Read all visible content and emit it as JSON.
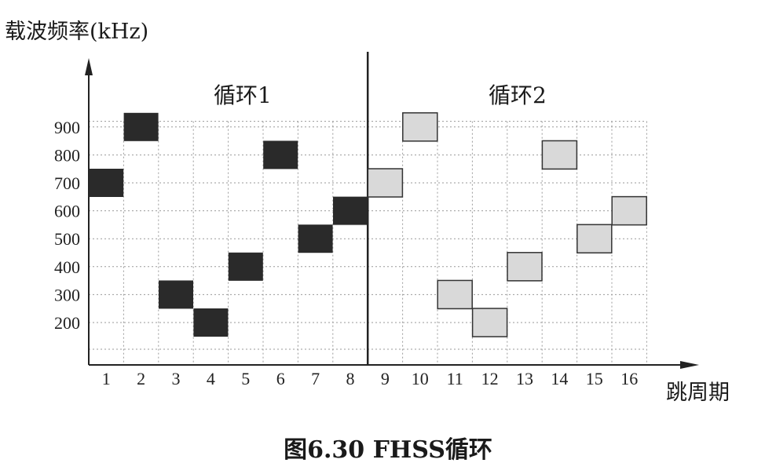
{
  "chart_data": {
    "type": "scatter",
    "title": "图6.30  FHSS循环",
    "ylabel": "载波频率(kHz)",
    "xlabel": "跳周期",
    "x_ticks": [
      1,
      2,
      3,
      4,
      5,
      6,
      7,
      8,
      9,
      10,
      11,
      12,
      13,
      14,
      15,
      16
    ],
    "y_ticks": [
      200,
      300,
      400,
      500,
      600,
      700,
      800,
      900
    ],
    "xlim": [
      0.5,
      16.5
    ],
    "ylim": [
      0,
      1000
    ],
    "grid": true,
    "cycle_divider_x": 8.5,
    "annotations": [
      "循环1",
      "循环2"
    ],
    "series": [
      {
        "color": "#2a2a2a",
        "points": [
          [
            1,
            700
          ],
          [
            2,
            900
          ],
          [
            3,
            300
          ],
          [
            4,
            200
          ],
          [
            5,
            400
          ],
          [
            6,
            800
          ],
          [
            7,
            500
          ],
          [
            8,
            600
          ]
        ]
      },
      {
        "color": "#d9d9d9",
        "points": [
          [
            9,
            700
          ],
          [
            10,
            900
          ],
          [
            11,
            300
          ],
          [
            12,
            200
          ],
          [
            13,
            400
          ],
          [
            14,
            800
          ],
          [
            15,
            500
          ],
          [
            16,
            600
          ]
        ]
      }
    ]
  }
}
